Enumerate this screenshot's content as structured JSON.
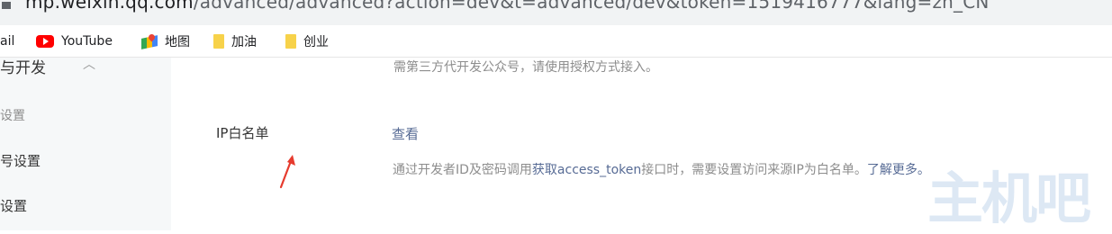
{
  "browser": {
    "url_host": "mp.weixin.qq.com",
    "url_path": "/advanced/advanced?action=dev&t=advanced/dev&token=1519416777&lang=zh_CN"
  },
  "bookmarks": {
    "gmail": "ail",
    "youtube": "YouTube",
    "map": "地图",
    "jiayou": "加油",
    "chuangye": "创业"
  },
  "sidebar": {
    "dev_label": "与开发",
    "basic_settings": "设置",
    "account_settings": "号设置",
    "security": "设置"
  },
  "main": {
    "note": "需第三方代开发公众号，请使用授权方式接入。",
    "ip_label": "IP白名单",
    "view_link": "查看",
    "desc_prefix": "通过开发者ID及密码调用",
    "desc_link": "获取access_token",
    "desc_suffix": "接口时，需要设置访问来源IP为白名单。",
    "learn_more": "了解更多。"
  },
  "watermark": "主机吧",
  "colors": {
    "link": "#576b95",
    "arrow": "#e63b2e"
  }
}
